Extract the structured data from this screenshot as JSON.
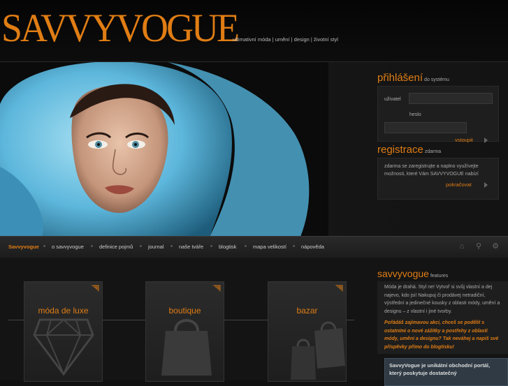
{
  "header": {
    "logo": "SAVVYVOGUE",
    "tagline": "ultimativní móda | umění | design | životní styl"
  },
  "login": {
    "title": "přihlášení",
    "subtitle": "do systému",
    "user_label": "uživatel",
    "password_label": "heslo",
    "submit": "vstoupit"
  },
  "registration": {
    "title": "registrace",
    "subtitle": "zdarma",
    "text": "zdarma se zaregistrujte a naplno využívejte možnosti, které Vám SAVVYVOGUE nabízí",
    "continue": "pokračovat"
  },
  "nav": {
    "items": [
      "Savvyvogue",
      "o savvyvogue",
      "definice pojmů",
      "journal",
      "naše tváře",
      "blogtisk",
      "mapa velikostí",
      "nápověda"
    ]
  },
  "categories": [
    "móda de luxe",
    "boutique",
    "bazar"
  ],
  "features": {
    "title": "savvyvogue",
    "subtitle": "features",
    "text": "Móda je drahá. Styl ne! Vytvoř si svůj vlastní a dej najevo, kdo jsi! Nakupuj či prodávej netradiční, výstřední a jedinečné kousky z oblasti módy, umění a designu – z vlastní i jiné tvorby.",
    "promo": "Pořádáš zajímavou akci, chceš se podělit s ostatními o nové zážitky a postřehy z oblasti módy, umění a designu? Tak neváhej a napiš své příspěvky přímo do blogtisku!",
    "box": "SavvyVogue je unikátní obchodní portál, který poskytuje dostatečný"
  },
  "colors": {
    "accent": "#e07d14",
    "background": "#111111",
    "scarf": "#6fc3e3"
  }
}
